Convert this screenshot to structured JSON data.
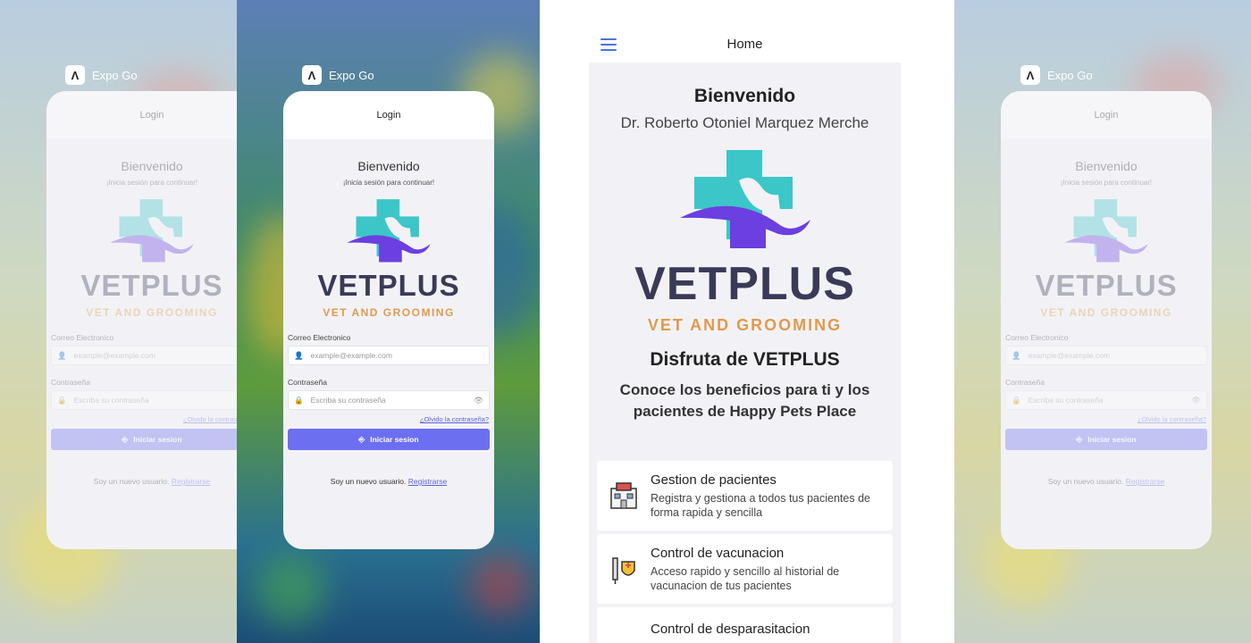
{
  "expo": {
    "label": "Expo Go"
  },
  "login": {
    "header_title": "Login",
    "welcome": "Bienvenido",
    "subtitle": "¡Inicia sesión para continuar!",
    "brand": "VETPLUS",
    "tagline": "VET AND GROOMING",
    "email_label": "Correo Electronico",
    "email_placeholder": "example@example.com",
    "password_label": "Contraseña",
    "password_placeholder": "Escriba su contraseña",
    "forgot_password": "¿Olvido la contraseña?",
    "login_button": "Iniciar sesion",
    "register_prompt": "Soy un nuevo usuario.",
    "register_link": "Registrarse"
  },
  "home": {
    "header_title": "Home",
    "welcome": "Bienvenido",
    "doctor_name": "Dr. Roberto Otoniel Marquez Merche",
    "brand": "VETPLUS",
    "tagline": "VET AND GROOMING",
    "enjoy": "Disfruta de VETPLUS",
    "benefits": "Conoce los beneficios para ti y los pacientes de Happy Pets Place",
    "features": [
      {
        "title": "Gestion de pacientes",
        "description": "Registra y gestiona a todos tus pacientes de forma rapida y sencilla",
        "icon": "hospital-icon"
      },
      {
        "title": "Control de vacunacion",
        "description": "Acceso rapido y sencillo al historial de vacunacion de tus pacientes",
        "icon": "vaccine-icon"
      },
      {
        "title": "Control de desparasitacion",
        "description": "",
        "icon": "deworm-icon"
      }
    ]
  },
  "colors": {
    "brand_teal": "#3cc6c8",
    "brand_purple": "#6b3fe0",
    "brand_text": "#3a3a58",
    "tagline": "#e09a4c",
    "button": "#6c6ff0",
    "link": "#5a63d6"
  }
}
